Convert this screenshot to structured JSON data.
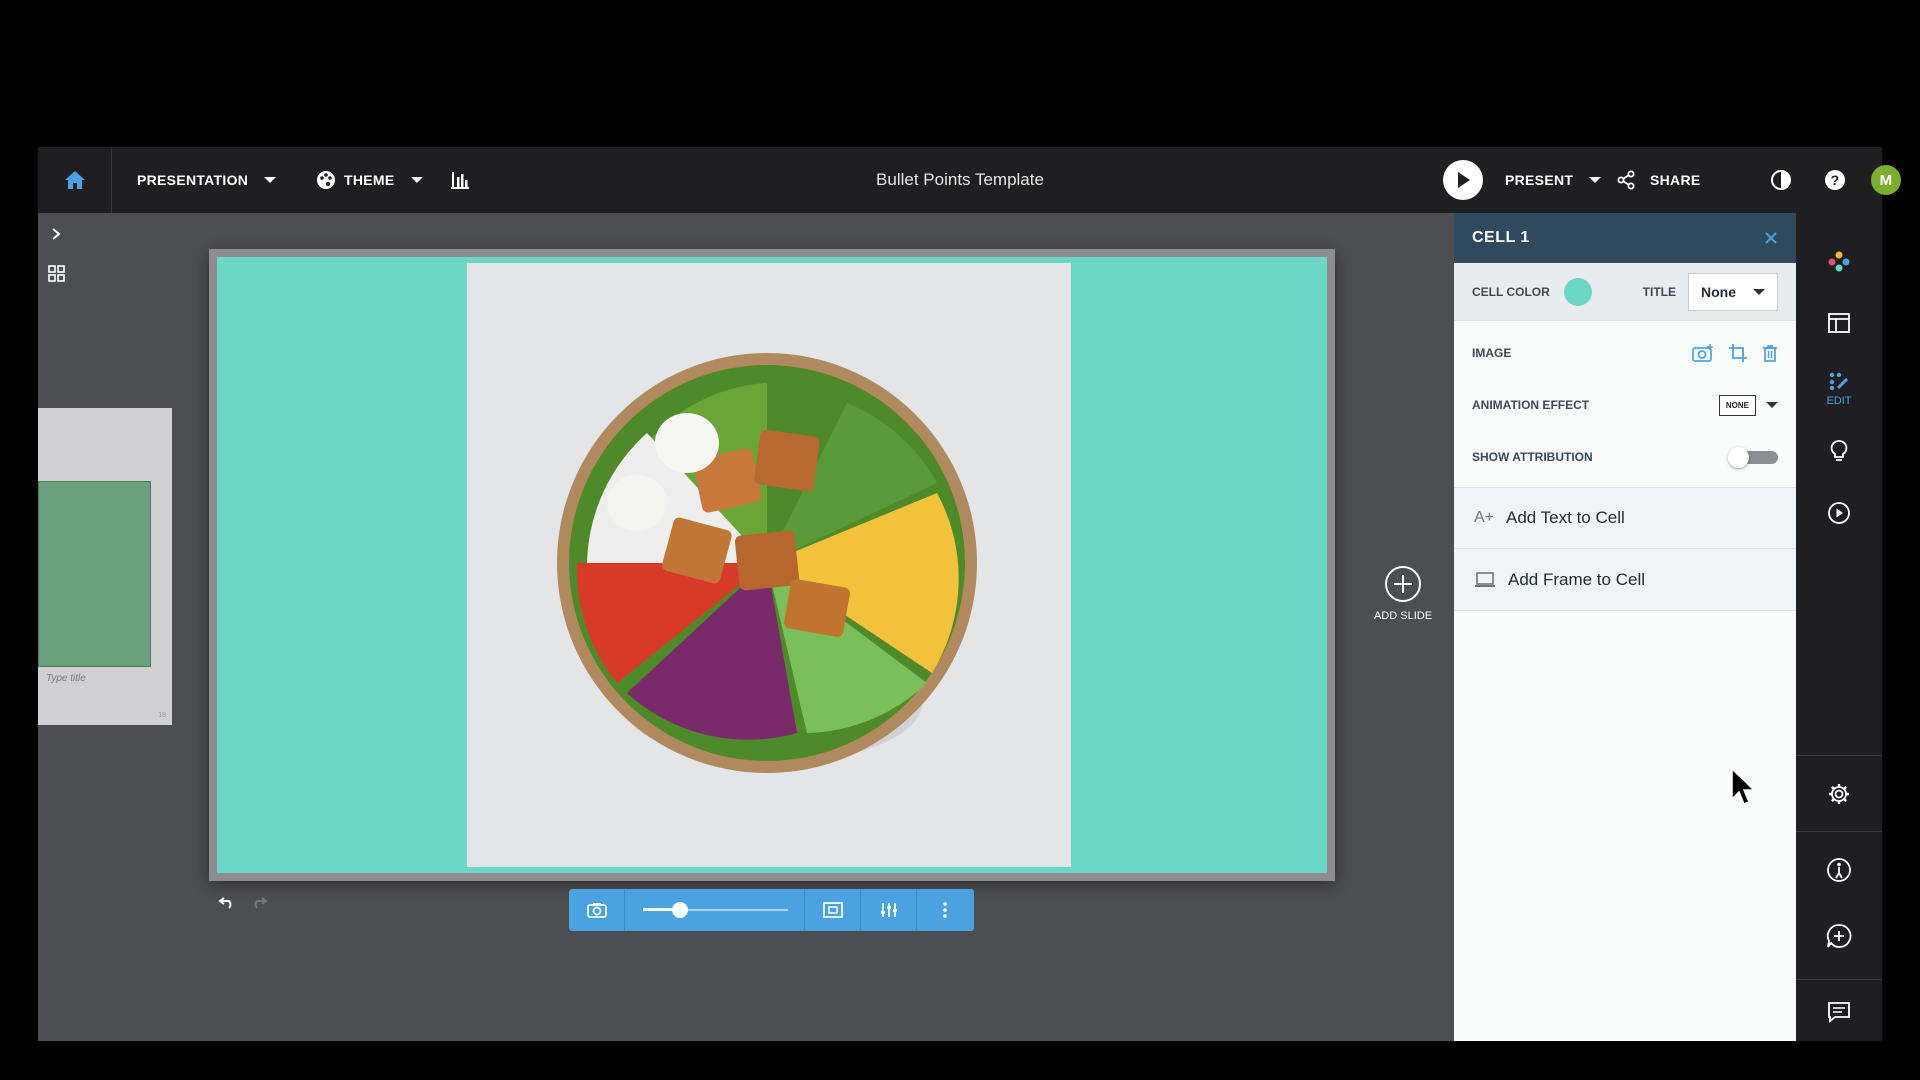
{
  "topbar": {
    "presentation_label": "PRESENTATION",
    "theme_label": "THEME",
    "doc_title": "Bullet Points Template",
    "present_label": "PRESENT",
    "share_label": "SHARE",
    "avatar_initial": "M"
  },
  "thumbnail": {
    "caption": "Type title",
    "number": "18"
  },
  "add_slide_label": "ADD SLIDE",
  "image_toolbar": {
    "zoom_fraction": 0.25
  },
  "panel": {
    "title": "CELL 1",
    "cell_color_label": "CELL COLOR",
    "cell_color": "#6cd6c4",
    "title_label": "TITLE",
    "title_value": "None",
    "image_label": "IMAGE",
    "animation_label": "ANIMATION EFFECT",
    "animation_value": "NONE",
    "attribution_label": "SHOW ATTRIBUTION",
    "attribution_on": false,
    "add_text_label": "Add Text to Cell",
    "add_frame_label": "Add Frame to Cell"
  },
  "right_rail": {
    "edit_label": "EDIT"
  },
  "colors": {
    "accent": "#4aa3e0",
    "slide_bg": "#6cd6c4",
    "panel_head": "#2f4a5c"
  }
}
